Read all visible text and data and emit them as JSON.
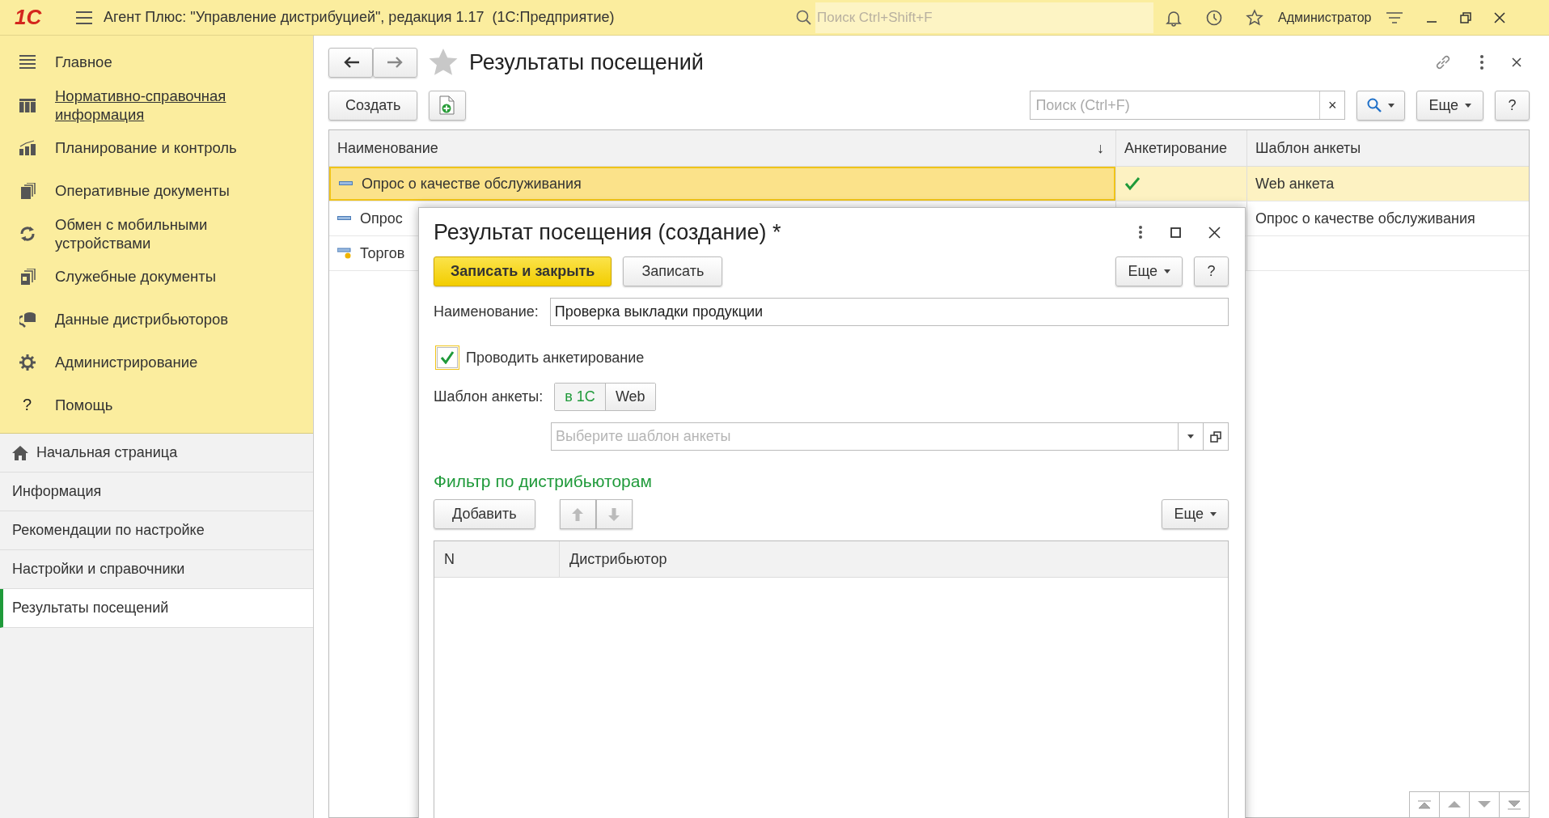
{
  "window": {
    "logo": "1С",
    "title": "Агент Плюс: \"Управление дистрибуцией\", редакция 1.17  (1С:Предприятие)",
    "search": {
      "placeholder": "Поиск Ctrl+Shift+F"
    },
    "user": "Администратор"
  },
  "sidebar": {
    "sections": [
      {
        "label": "Главное",
        "selected": false
      },
      {
        "label": "Нормативно-справочная информация",
        "selected": true
      },
      {
        "label": "Планирование и контроль",
        "selected": false
      },
      {
        "label": "Оперативные документы",
        "selected": false
      },
      {
        "label": "Обмен с мобильными устройствами",
        "selected": false
      },
      {
        "label": "Служебные документы",
        "selected": false
      },
      {
        "label": "Данные дистрибьюторов",
        "selected": false
      },
      {
        "label": "Администрирование",
        "selected": false
      },
      {
        "label": "Помощь",
        "selected": false,
        "kind": "help",
        "icon_char": "?"
      }
    ],
    "open_pages": [
      {
        "label": "Начальная страница",
        "selected": false,
        "kind": "home"
      },
      {
        "label": "Информация",
        "selected": false,
        "kind": "page"
      },
      {
        "label": "Рекомендации по настройке",
        "selected": false,
        "kind": "page"
      },
      {
        "label": "Настройки и справочники",
        "selected": false,
        "kind": "page"
      },
      {
        "label": "Результаты посещений",
        "selected": true,
        "kind": "page"
      }
    ]
  },
  "form": {
    "title": "Результаты посещений",
    "create_button": "Создать",
    "search": {
      "placeholder": "Поиск (Ctrl+F)",
      "clear": "×"
    },
    "more_button": "Еще",
    "help_button": "?",
    "table": {
      "columns": [
        {
          "label": "Наименование",
          "sort": "↓"
        },
        {
          "label": "Анкетирование"
        },
        {
          "label": "Шаблон анкеты"
        }
      ],
      "rows": [
        {
          "name": "Опрос о качестве обслуживания",
          "survey": true,
          "template": "Web анкета",
          "selected": true,
          "kind": "plain"
        },
        {
          "name": "Опрос",
          "template": "Опрос о качестве обслуживания",
          "selected": false,
          "kind": "plain"
        },
        {
          "name": "Торгов",
          "selected": false,
          "kind": "marked"
        }
      ]
    }
  },
  "dialog": {
    "title": "Результат посещения (создание) *",
    "save_close_button": "Записать и закрыть",
    "save_button": "Записать",
    "more_button": "Еще",
    "help_button": "?",
    "name_field": {
      "label": "Наименование:",
      "value": "Проверка выкладки продукции"
    },
    "survey_checkbox": {
      "label": "Проводить анкетирование",
      "checked": true
    },
    "template_type": {
      "label": "Шаблон анкеты:",
      "options": [
        {
          "label": "в 1С",
          "selected": true
        },
        {
          "label": "Web",
          "selected": false
        }
      ]
    },
    "template_select": {
      "placeholder": "Выберите шаблон анкеты"
    },
    "filter": {
      "heading": "Фильтр по дистрибьюторам",
      "add_button": "Добавить",
      "move_buttons": {
        "disabled": true
      },
      "more_button": "Еще",
      "table": {
        "columns": [
          "N",
          "Дистрибьютор"
        ]
      }
    }
  }
}
